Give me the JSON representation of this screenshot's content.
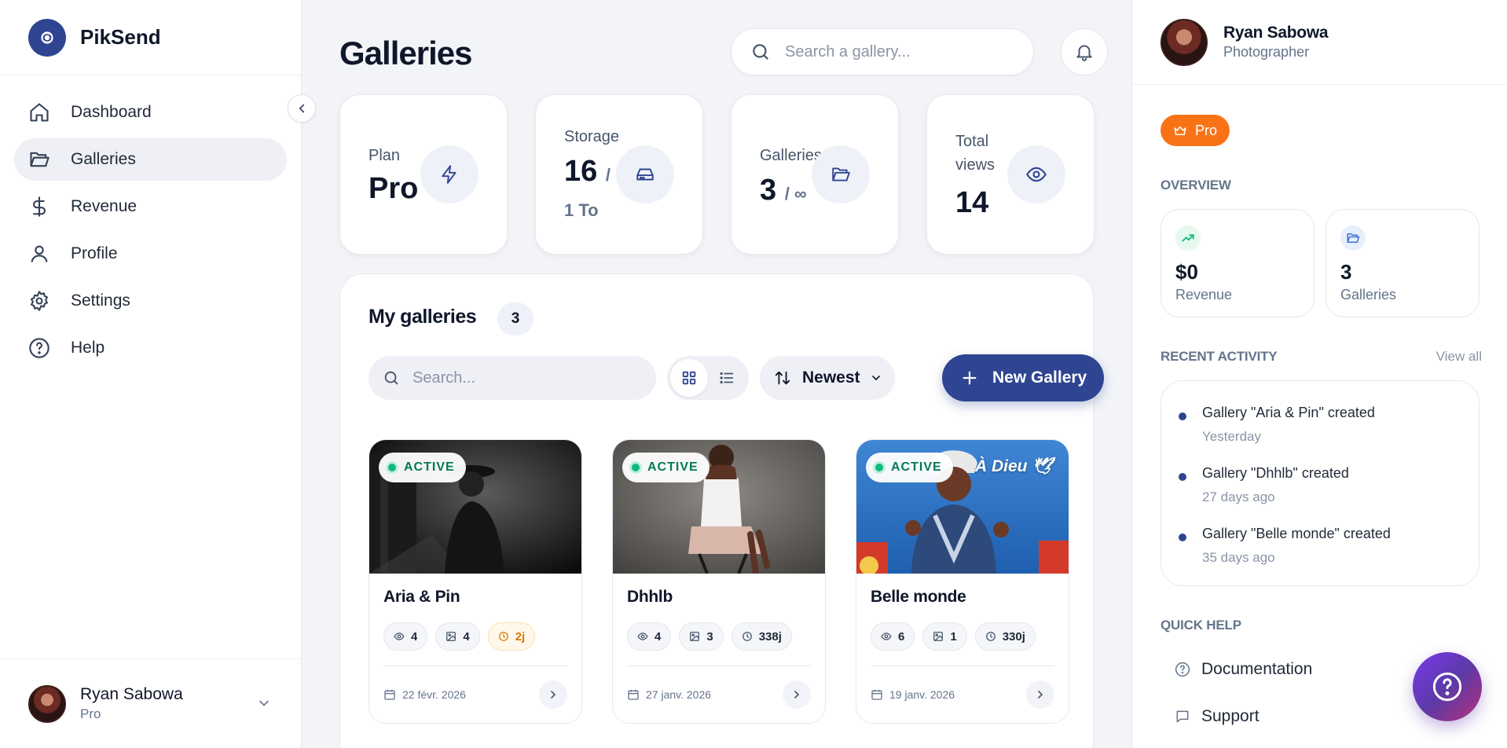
{
  "app": {
    "name": "PikSend",
    "logo_icon": "camera-swirl-icon"
  },
  "sidebar": {
    "items": [
      {
        "label": "Dashboard",
        "icon": "home-icon",
        "active": false
      },
      {
        "label": "Galleries",
        "icon": "folder-open-icon",
        "active": true
      },
      {
        "label": "Revenue",
        "icon": "dollar-icon",
        "active": false
      },
      {
        "label": "Profile",
        "icon": "user-icon",
        "active": false
      },
      {
        "label": "Settings",
        "icon": "gear-icon",
        "active": false
      },
      {
        "label": "Help",
        "icon": "help-circle-icon",
        "active": false
      }
    ],
    "user": {
      "name": "Ryan Sabowa",
      "plan": "Pro"
    }
  },
  "header": {
    "title": "Galleries",
    "search_placeholder": "Search a gallery..."
  },
  "stats": [
    {
      "label": "Plan",
      "value": "Pro",
      "sub": "",
      "icon": "bolt-icon"
    },
    {
      "label": "Storage",
      "value": "16",
      "sub": "/",
      "sub2": "1 To",
      "icon": "hard-drive-icon"
    },
    {
      "label": "Galleries",
      "value": "3",
      "sub": "/ ∞",
      "icon": "folder-open-icon"
    },
    {
      "label": "Total views",
      "value": "14",
      "sub": "",
      "icon": "eye-icon"
    }
  ],
  "my_galleries": {
    "title": "My galleries",
    "count": "3",
    "search_placeholder": "Search...",
    "view_mode": "grid",
    "sort_label": "Newest",
    "new_button": "New Gallery",
    "galleries": [
      {
        "title": "Aria & Pin",
        "status": "ACTIVE",
        "views": "4",
        "photos": "4",
        "remaining": "2j",
        "remaining_warn": true,
        "date": "22 févr. 2026",
        "caption": ""
      },
      {
        "title": "Dhhlb",
        "status": "ACTIVE",
        "views": "4",
        "photos": "3",
        "remaining": "338j",
        "remaining_warn": false,
        "date": "27 janv. 2026",
        "caption": ""
      },
      {
        "title": "Belle monde",
        "status": "ACTIVE",
        "views": "6",
        "photos": "1",
        "remaining": "330j",
        "remaining_warn": false,
        "date": "19 janv. 2026",
        "caption": "À Dieu 🕊"
      }
    ]
  },
  "right_panel": {
    "user": {
      "name": "Ryan Sabowa",
      "role": "Photographer"
    },
    "plan_badge": "Pro",
    "overview_title": "OVERVIEW",
    "overview": [
      {
        "value": "$0",
        "label": "Revenue",
        "icon": "trending-up-icon",
        "color": "#10b981"
      },
      {
        "value": "3",
        "label": "Galleries",
        "icon": "folder-open-icon",
        "color": "#3b6fd6"
      }
    ],
    "activity_title": "RECENT ACTIVITY",
    "activity_link": "View all",
    "activity": [
      {
        "text": "Gallery \"Aria & Pin\" created",
        "time": "Yesterday"
      },
      {
        "text": "Gallery \"Dhhlb\" created",
        "time": "27 days ago"
      },
      {
        "text": "Gallery \"Belle monde\" created",
        "time": "35 days ago"
      }
    ],
    "help_title": "QUICK HELP",
    "help_items": [
      {
        "label": "Documentation",
        "icon": "help-circle-icon"
      },
      {
        "label": "Support",
        "icon": "chat-icon"
      }
    ]
  },
  "colors": {
    "primary": "#2f4592",
    "accent": "#f97316",
    "active_status": "#10b981",
    "warning": "#d97706"
  }
}
